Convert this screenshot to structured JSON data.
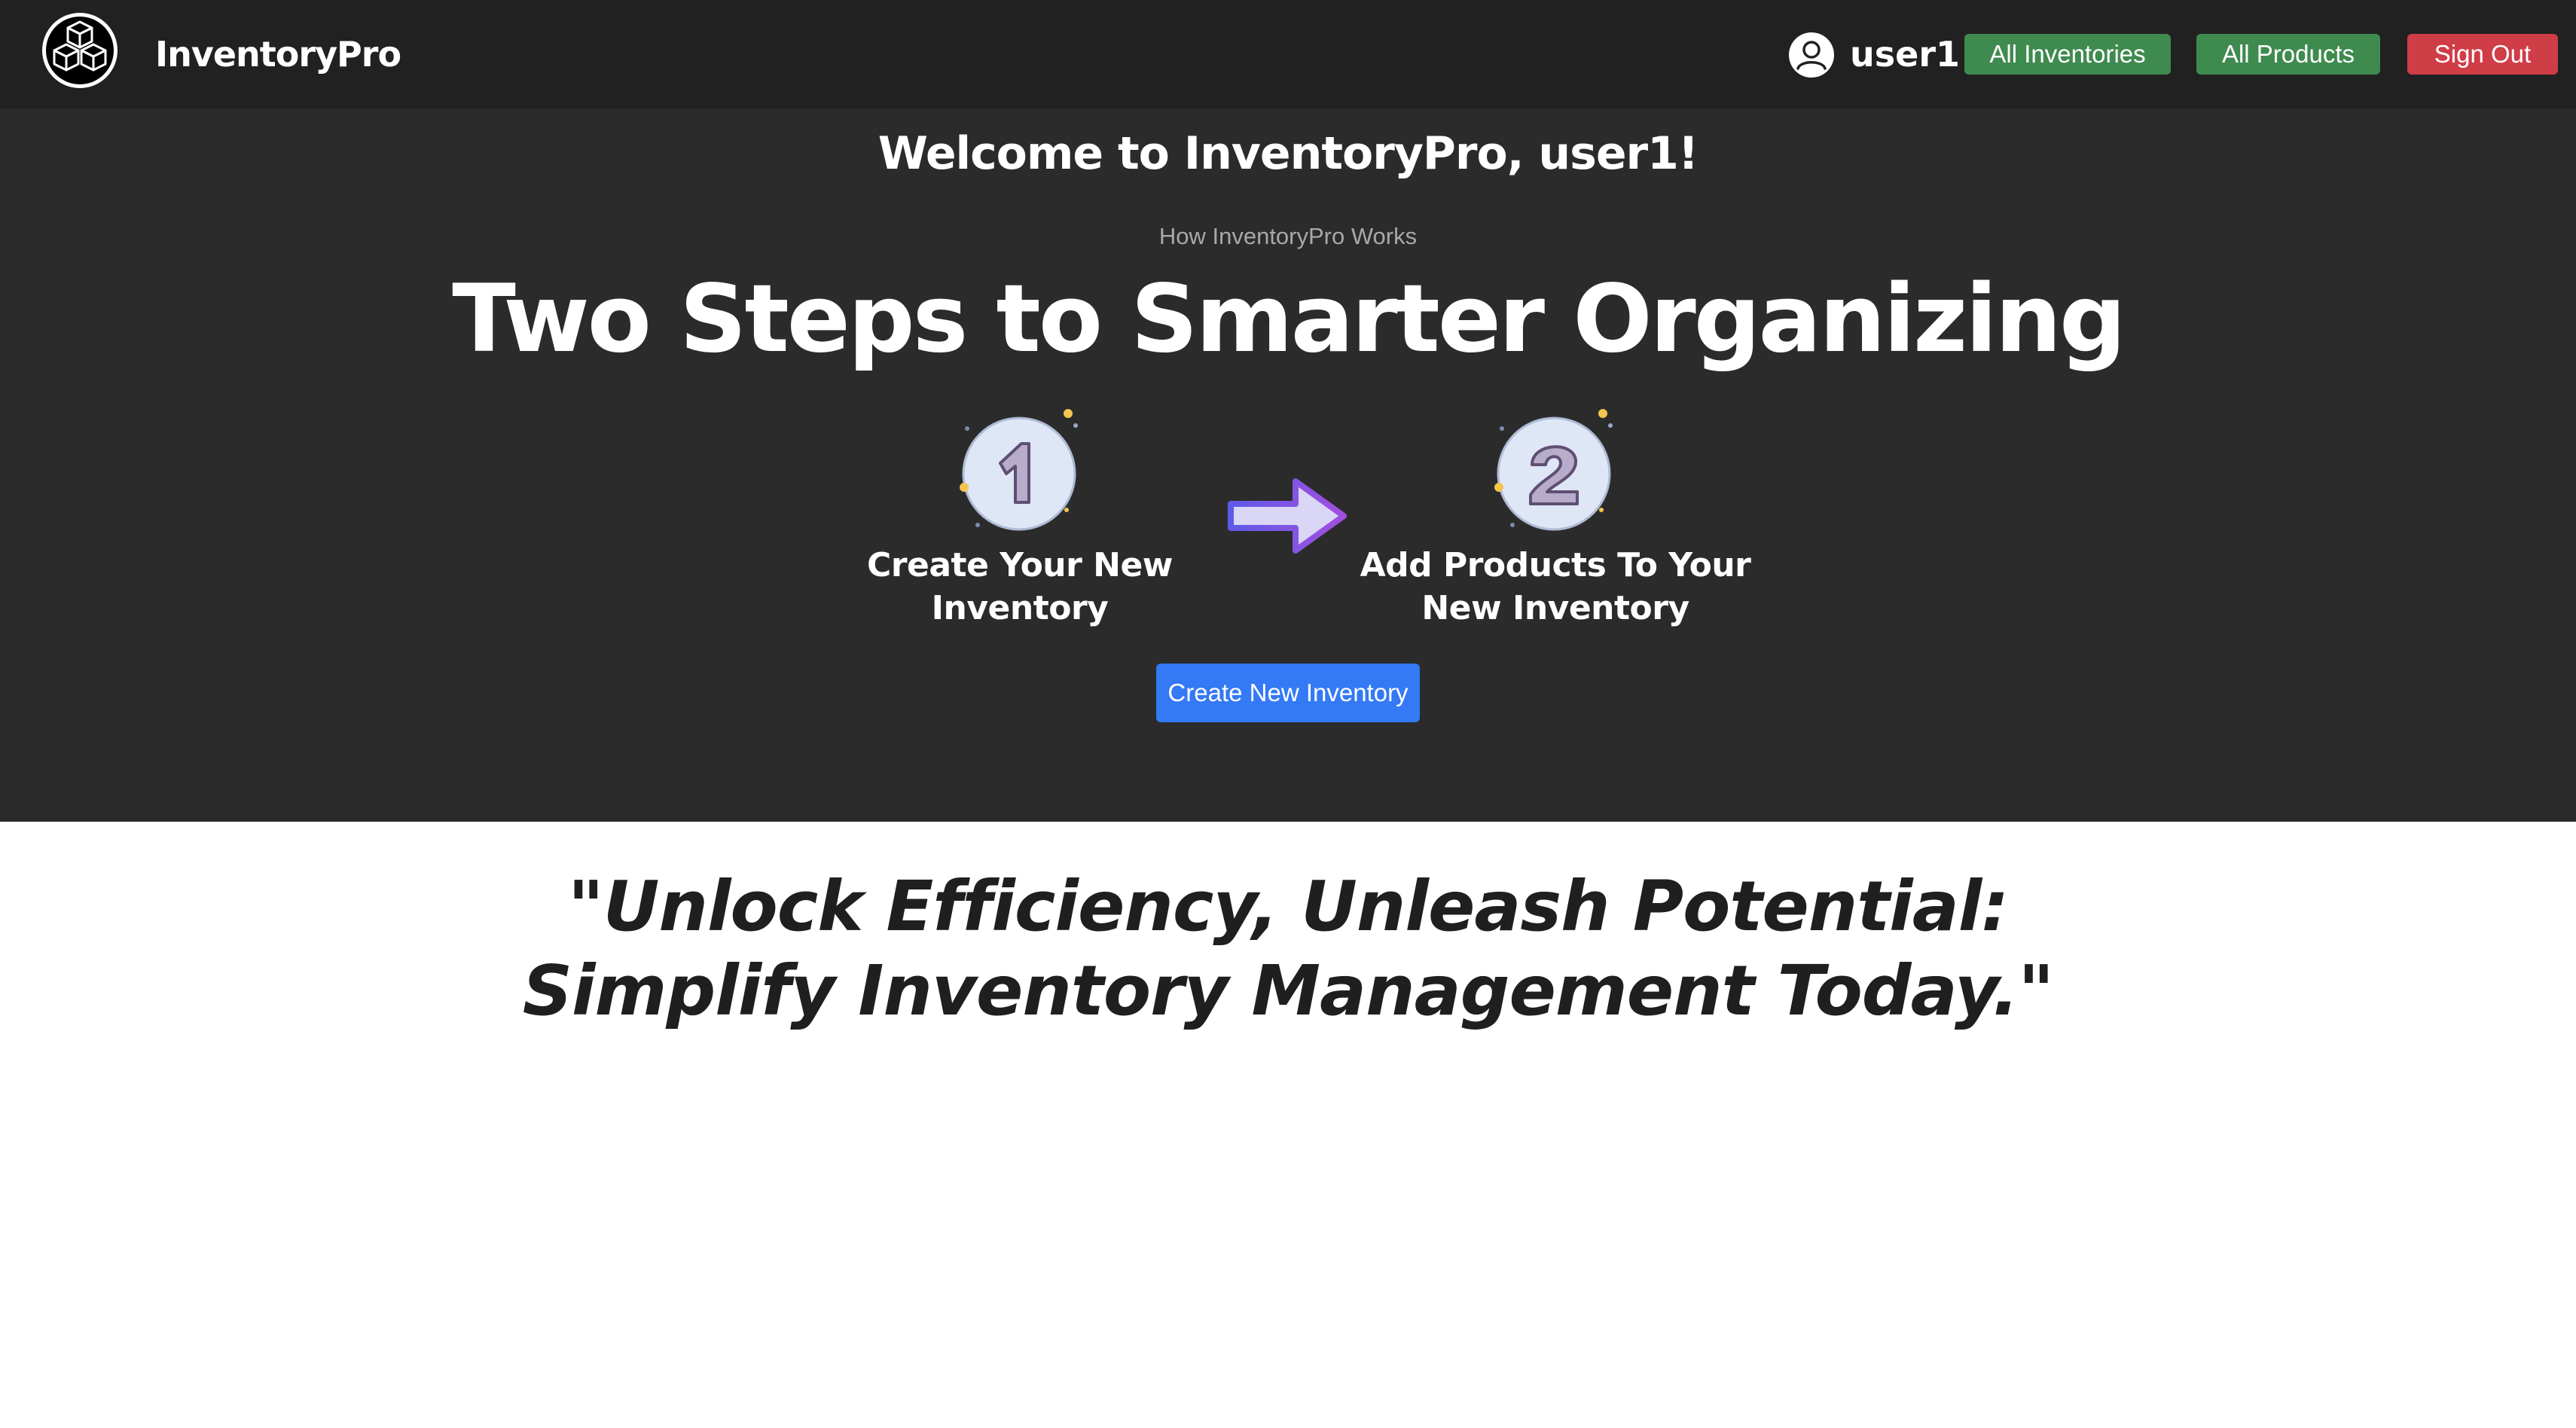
{
  "navbar": {
    "brand": "InventoryPro",
    "logo_icon": "cubes-logo-icon",
    "user_icon": "user-circle-icon",
    "username": "user1",
    "buttons": {
      "all_inventories": "All Inventories",
      "all_products": "All Products",
      "sign_out": "Sign Out"
    }
  },
  "hero": {
    "welcome": "Welcome to InventoryPro, user1!",
    "subheading": "How InventoryPro Works",
    "headline": "Two Steps to Smarter Organizing",
    "steps": [
      {
        "number": "1",
        "icon": "number-one-badge-icon",
        "label": "Create Your New Inventory"
      },
      {
        "number": "2",
        "icon": "number-two-badge-icon",
        "label": "Add Products To Your New Inventory"
      }
    ],
    "arrow_icon": "right-arrow-icon",
    "cta": "Create New Inventory"
  },
  "quote": {
    "line1": "\"Unlock Efficiency, Unleash Potential:",
    "line2": "Simplify Inventory Management Today.\""
  },
  "colors": {
    "navbar_bg": "#212121",
    "hero_bg": "#2b2b2b",
    "green_button": "#3f8a4f",
    "red_button": "#cf3d47",
    "blue_button": "#3479f5"
  }
}
